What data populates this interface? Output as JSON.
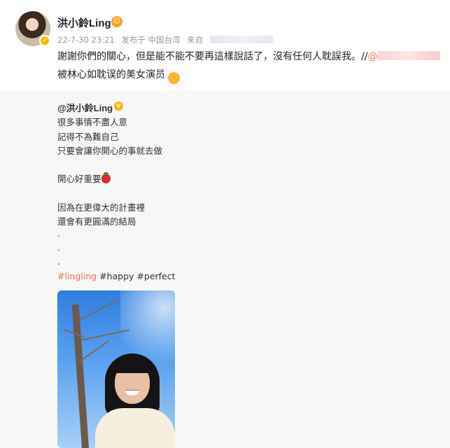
{
  "post": {
    "username": "洪小鈴Ling",
    "timestamp": "22-7-30 23:21",
    "published_at": "发布于 中国台湾",
    "source_label": "来自",
    "text": "謝謝你們的關心，但是能不能不要再這樣說話了，沒有任何人耽誤我。//",
    "mention_prefix": "@",
    "second_line": "被林心如耽误的美女演员"
  },
  "repost": {
    "author": "@洪小鈴Ling",
    "lines": [
      "很多事情不盡人意",
      "記得不為難自己",
      "只要會讓你開心的事就去做",
      "",
      "開心好重要",
      "",
      "因為在更偉大的計畫裡",
      "還會有更圓滿的結局",
      ".",
      ".",
      "."
    ],
    "hashtags": [
      "#lingling",
      "#happy",
      "#perfect"
    ]
  },
  "colors": {
    "hashtag_accent": "#eb7350",
    "verified_badge": "#f5b800",
    "repost_background": "#f7f7f7"
  },
  "icons": {
    "avatar_badge": "verified-badge-icon",
    "user_emoji": "emoji-icon",
    "tongue_emoji": "tongue-emoji-icon",
    "strawberry": "strawberry-icon"
  }
}
